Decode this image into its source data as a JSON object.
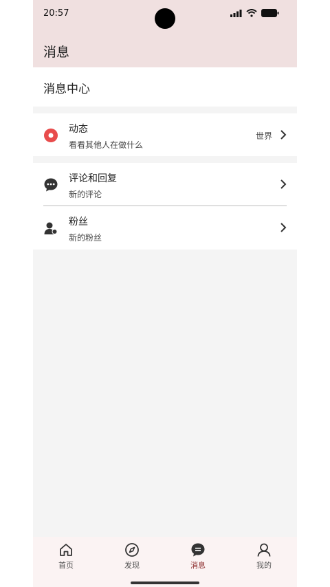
{
  "status_bar": {
    "time": "20:57"
  },
  "header": {
    "title": "消息"
  },
  "section": {
    "title": "消息中心"
  },
  "rows": [
    {
      "title": "动态",
      "subtitle": "看看其他人在做什么",
      "extra": "世界",
      "icon": "record-icon"
    },
    {
      "title": "评论和回复",
      "subtitle": "新的评论",
      "icon": "comment-icon"
    },
    {
      "title": "粉丝",
      "subtitle": "新的粉丝",
      "icon": "follower-icon"
    }
  ],
  "tabs": [
    {
      "label": "首页",
      "icon": "home-icon"
    },
    {
      "label": "发现",
      "icon": "compass-icon"
    },
    {
      "label": "消息",
      "icon": "message-icon",
      "active": true
    },
    {
      "label": "我的",
      "icon": "profile-icon"
    }
  ],
  "colors": {
    "accent": "#e84c4c",
    "active_tab": "#8b2a2a",
    "header_bg": "#f0e0e0"
  }
}
